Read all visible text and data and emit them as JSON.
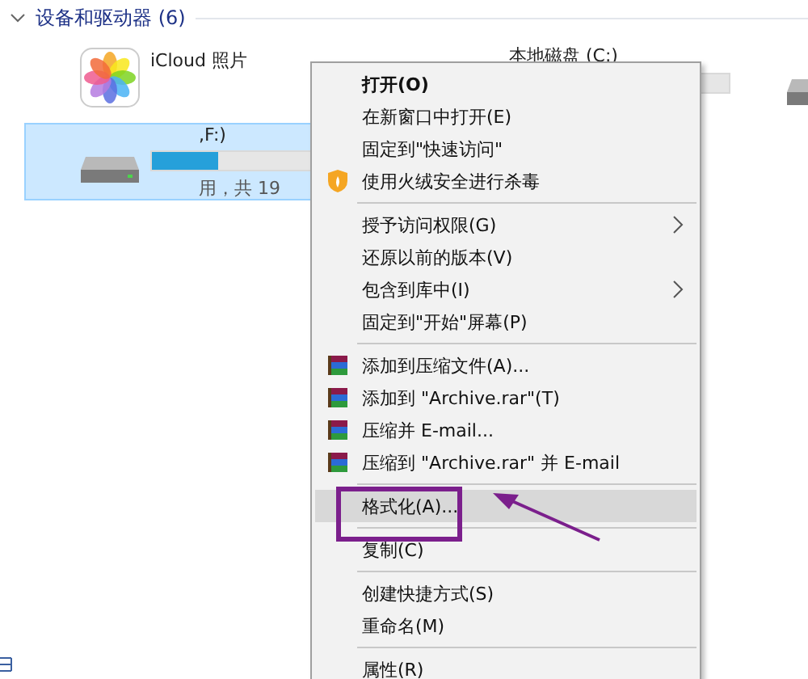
{
  "section": {
    "title": "设备和驱动器 (6)",
    "expanded": true
  },
  "devices": [
    {
      "kind": "photos",
      "name": "iCloud 照片",
      "selected": false
    },
    {
      "kind": "drive",
      "name": "本地磁盘 (C:)",
      "selected": false
    },
    {
      "kind": "drive-icon-only",
      "selected": false
    },
    {
      "kind": "drive",
      "name": ",F:)",
      "detail": "用，共 19",
      "selected": true,
      "level": 0.3
    }
  ],
  "context_menu": [
    {
      "kind": "item",
      "label": "打开(O)",
      "bold": true,
      "selected": false
    },
    {
      "kind": "item",
      "label": "在新窗口中打开(E)",
      "selected": false
    },
    {
      "kind": "item",
      "label": "固定到\"快速访问\"",
      "selected": false
    },
    {
      "kind": "antivirus",
      "label": "使用火绒安全进行杀毒",
      "selected": false
    },
    {
      "kind": "separator"
    },
    {
      "kind": "item",
      "label": "授予访问权限(G)",
      "submenu": true,
      "selected": false
    },
    {
      "kind": "item",
      "label": "还原以前的版本(V)",
      "selected": false
    },
    {
      "kind": "item",
      "label": "包含到库中(I)",
      "submenu": true,
      "selected": false
    },
    {
      "kind": "item",
      "label": "固定到\"开始\"屏幕(P)",
      "selected": false
    },
    {
      "kind": "separator"
    },
    {
      "kind": "archive",
      "label": "添加到压缩文件(A)...",
      "selected": false
    },
    {
      "kind": "archive",
      "label": "添加到 \"Archive.rar\"(T)",
      "selected": false
    },
    {
      "kind": "archive",
      "label": "压缩并 E-mail...",
      "selected": false
    },
    {
      "kind": "archive",
      "label": "压缩到 \"Archive.rar\" 并 E-mail",
      "selected": false
    },
    {
      "kind": "separator"
    },
    {
      "kind": "item",
      "label": "格式化(A)...",
      "selected": true,
      "annotated": true
    },
    {
      "kind": "separator"
    },
    {
      "kind": "item",
      "label": "复制(C)",
      "selected": false
    },
    {
      "kind": "separator"
    },
    {
      "kind": "item",
      "label": "创建快捷方式(S)",
      "selected": false
    },
    {
      "kind": "item",
      "label": "重命名(M)",
      "selected": false
    },
    {
      "kind": "separator"
    },
    {
      "kind": "item",
      "label": "属性(R)",
      "selected": false
    }
  ]
}
